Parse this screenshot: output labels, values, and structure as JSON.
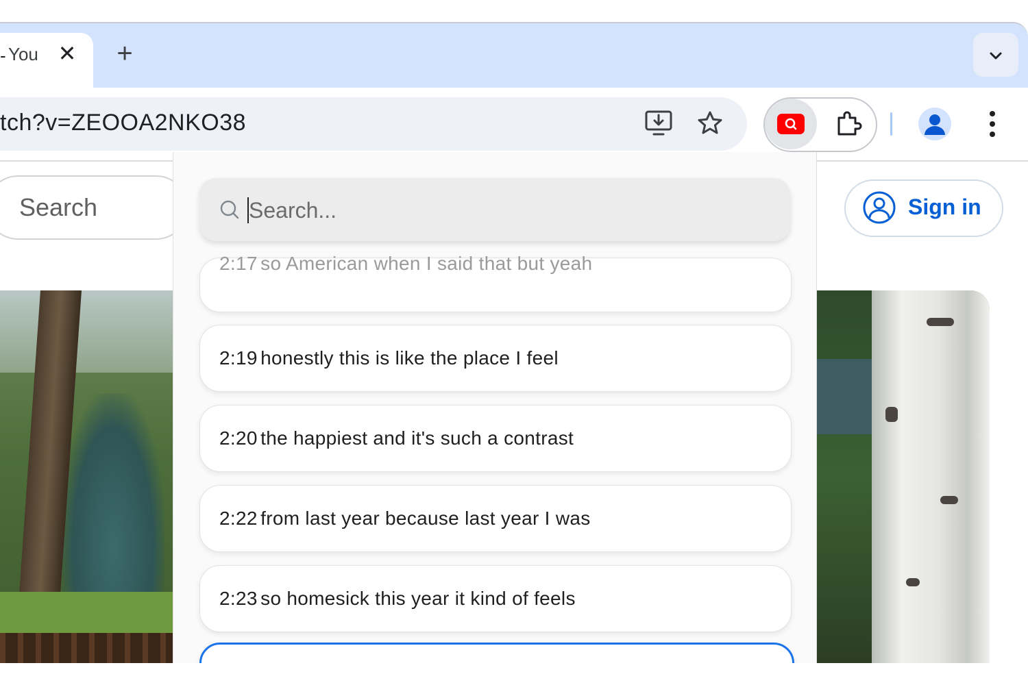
{
  "browser": {
    "tab": {
      "dash": "-",
      "title": "You",
      "close": "✕"
    },
    "new_tab": "+",
    "address": {
      "url": "tch?v=ZEOOA2NKO38"
    }
  },
  "youtube": {
    "search_placeholder": "Search",
    "sign_in_label": "Sign in"
  },
  "transcript_popup": {
    "search_placeholder": "Search...",
    "results": [
      {
        "timestamp": "2:17",
        "text": "so American when I said that but yeah"
      },
      {
        "timestamp": "2:19",
        "text": "honestly this is like the place I feel"
      },
      {
        "timestamp": "2:20",
        "text": "the happiest and it's such a contrast"
      },
      {
        "timestamp": "2:22",
        "text": "from last year because last year I was"
      },
      {
        "timestamp": "2:23",
        "text": "so homesick this year it kind of feels"
      },
      {
        "timestamp": "",
        "text": ""
      }
    ]
  },
  "colors": {
    "accent": "#1a73e8",
    "tabbar": "#d3e3fd",
    "youtube_red": "#ff0000",
    "signin_blue": "#065fd4"
  }
}
